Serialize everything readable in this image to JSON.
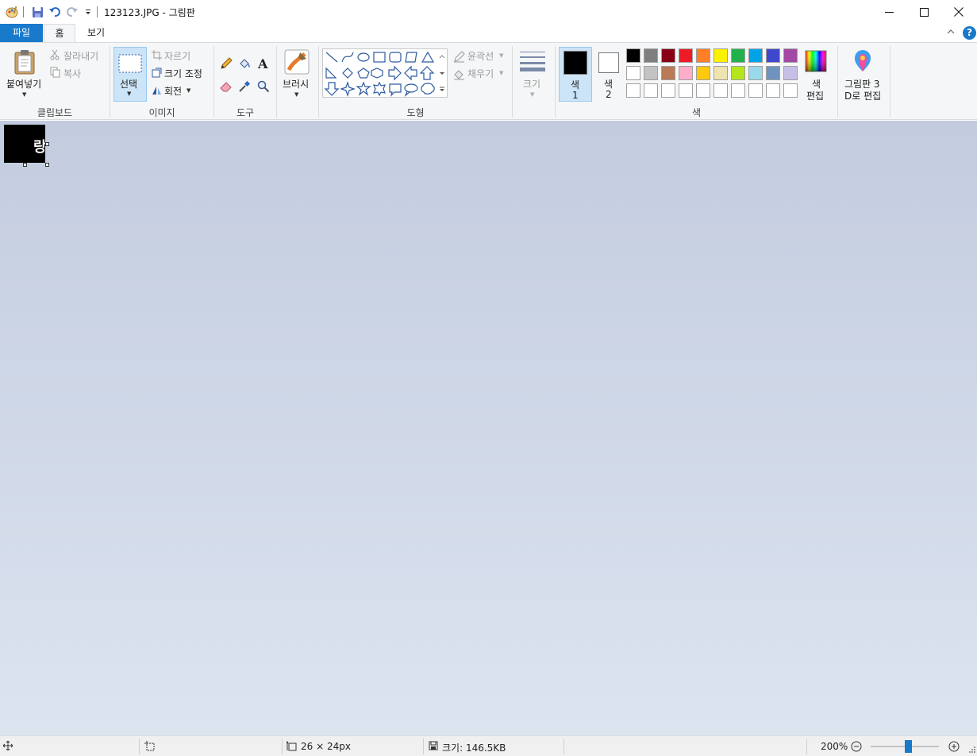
{
  "window": {
    "title": "123123.JPG - 그림판",
    "minimize_icon": "minimize-icon",
    "maximize_icon": "maximize-icon",
    "close_icon": "close-icon"
  },
  "quick_access": {
    "icons": [
      "paint-app-icon",
      "save-icon",
      "undo-icon",
      "redo-icon",
      "customize-dropdown-icon"
    ]
  },
  "tabs": {
    "file": "파일",
    "home": "홈",
    "view": "보기"
  },
  "ribbon": {
    "clipboard": {
      "paste": "붙여넣기",
      "cut": "잘라내기",
      "copy": "복사",
      "group_label": "클립보드"
    },
    "image": {
      "select": "선택",
      "crop": "자르기",
      "resize": "크기 조정",
      "rotate": "회전",
      "group_label": "이미지"
    },
    "tools": {
      "group_label": "도구",
      "icons": [
        "pencil-icon",
        "fill-bucket-icon",
        "text-tool-icon",
        "eraser-icon",
        "color-picker-icon",
        "magnifier-icon"
      ]
    },
    "brushes": {
      "label": "브러시"
    },
    "shapes": {
      "outline": "윤곽선",
      "fill": "채우기",
      "group_label": "도형"
    },
    "size": {
      "label": "크기"
    },
    "colors": {
      "color1_label": "색",
      "color1_num": "1",
      "color2_label": "색",
      "color2_num": "2",
      "edit_colors_line1": "색",
      "edit_colors_line2": "편집",
      "group_label": "색",
      "color1": "#000000",
      "color2": "#ffffff",
      "palette_row1": [
        "#000000",
        "#7f7f7f",
        "#880015",
        "#ed1c24",
        "#ff7f27",
        "#fff200",
        "#22b14c",
        "#00a2e8",
        "#3f48cc",
        "#a349a4"
      ],
      "palette_row2": [
        "#ffffff",
        "#c3c3c3",
        "#b97a57",
        "#ffaec9",
        "#ffc90e",
        "#efe4b0",
        "#b5e61d",
        "#99d9ea",
        "#7092be",
        "#c8bfe7"
      ],
      "palette_row3": [
        "#ffffff",
        "#ffffff",
        "#ffffff",
        "#ffffff",
        "#ffffff",
        "#ffffff",
        "#ffffff",
        "#ffffff",
        "#ffffff",
        "#ffffff"
      ]
    },
    "paint3d": {
      "line1": "그림판 3",
      "line2": "D로 편집"
    }
  },
  "canvas": {
    "image_text": "랑"
  },
  "status": {
    "selection_size": "26 × 24px",
    "file_size": "크기: 146.5KB",
    "zoom": "200%",
    "zoom_level_fraction": 0.55
  }
}
